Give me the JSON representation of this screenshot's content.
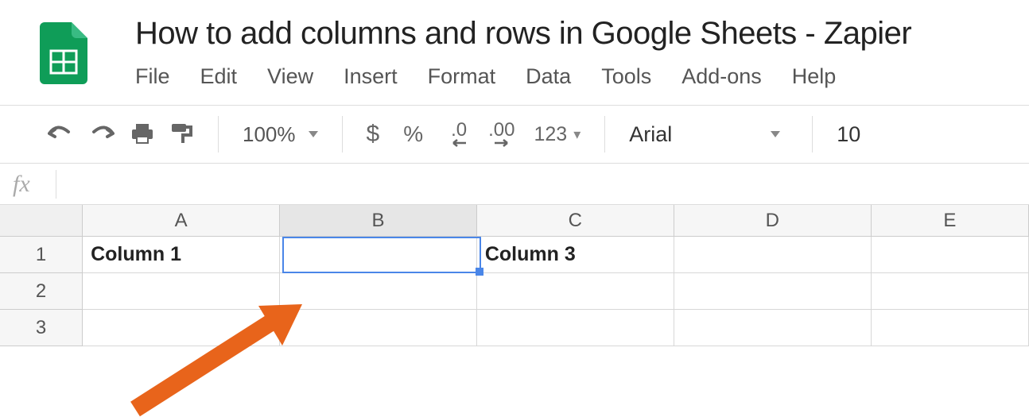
{
  "doc_title": "How to add columns and rows in Google Sheets - Zapier",
  "menubar": {
    "file": "File",
    "edit": "Edit",
    "view": "View",
    "insert": "Insert",
    "format": "Format",
    "data": "Data",
    "tools": "Tools",
    "addons": "Add-ons",
    "help": "Help"
  },
  "toolbar": {
    "zoom": "100%",
    "currency": "$",
    "percent": "%",
    "dec_less": ".0",
    "dec_more": ".00",
    "num_fmt": "123",
    "font": "Arial",
    "font_size": "10"
  },
  "formula": "",
  "columns": [
    "A",
    "B",
    "C",
    "D",
    "E"
  ],
  "selected_column_index": 1,
  "rows": [
    "1",
    "2",
    "3"
  ],
  "cells": {
    "A1": "Column 1",
    "B1": "",
    "C1": "Column 3",
    "D1": "",
    "E1": ""
  },
  "selected_cell": "B1",
  "annotation": "orange-arrow pointing to inserted blank column B"
}
